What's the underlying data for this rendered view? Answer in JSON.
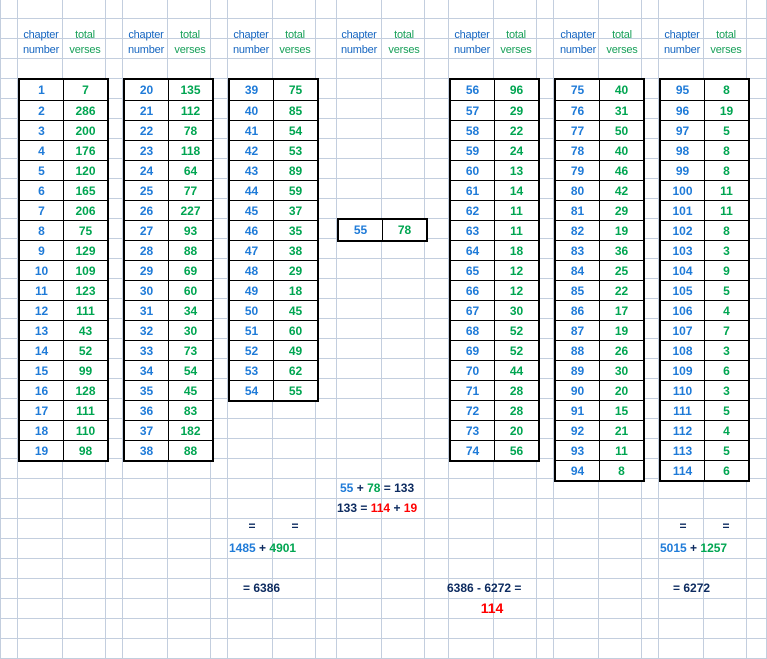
{
  "sheet": {
    "title": "Quran chapter verse counts worksheet",
    "header": {
      "chapter_line1": "chapter",
      "chapter_line2": "number",
      "verses_line1": "total",
      "verses_line2": "verses"
    },
    "colors": {
      "chapter": "#1f7bd8",
      "verses": "#00a551",
      "navy": "#0d2b60",
      "red": "#ff0000",
      "gridline": "#c3cede",
      "border": "#000000"
    }
  },
  "chart_data": {
    "type": "table",
    "title": "Quran chapter verse counts worksheet",
    "columns": [
      "chapter number",
      "total verses"
    ],
    "blocks": [
      {
        "id": "block-1",
        "rows": [
          [
            1,
            7
          ],
          [
            2,
            286
          ],
          [
            3,
            200
          ],
          [
            4,
            176
          ],
          [
            5,
            120
          ],
          [
            6,
            165
          ],
          [
            7,
            206
          ],
          [
            8,
            75
          ],
          [
            9,
            129
          ],
          [
            10,
            109
          ],
          [
            11,
            123
          ],
          [
            12,
            111
          ],
          [
            13,
            43
          ],
          [
            14,
            52
          ],
          [
            15,
            99
          ],
          [
            16,
            128
          ],
          [
            17,
            111
          ],
          [
            18,
            110
          ],
          [
            19,
            98
          ]
        ]
      },
      {
        "id": "block-2",
        "rows": [
          [
            20,
            135
          ],
          [
            21,
            112
          ],
          [
            22,
            78
          ],
          [
            23,
            118
          ],
          [
            24,
            64
          ],
          [
            25,
            77
          ],
          [
            26,
            227
          ],
          [
            27,
            93
          ],
          [
            28,
            88
          ],
          [
            29,
            69
          ],
          [
            30,
            60
          ],
          [
            31,
            34
          ],
          [
            32,
            30
          ],
          [
            33,
            73
          ],
          [
            34,
            54
          ],
          [
            35,
            45
          ],
          [
            36,
            83
          ],
          [
            37,
            182
          ],
          [
            38,
            88
          ]
        ]
      },
      {
        "id": "block-3",
        "rows": [
          [
            39,
            75
          ],
          [
            40,
            85
          ],
          [
            41,
            54
          ],
          [
            42,
            53
          ],
          [
            43,
            89
          ],
          [
            44,
            59
          ],
          [
            45,
            37
          ],
          [
            46,
            35
          ],
          [
            47,
            38
          ],
          [
            48,
            29
          ],
          [
            49,
            18
          ],
          [
            50,
            45
          ],
          [
            51,
            60
          ],
          [
            52,
            49
          ],
          [
            53,
            62
          ],
          [
            54,
            55
          ]
        ]
      },
      {
        "id": "block-4",
        "rows": [
          [
            55,
            78
          ]
        ]
      },
      {
        "id": "block-5",
        "rows": [
          [
            56,
            96
          ],
          [
            57,
            29
          ],
          [
            58,
            22
          ],
          [
            59,
            24
          ],
          [
            60,
            13
          ],
          [
            61,
            14
          ],
          [
            62,
            11
          ],
          [
            63,
            11
          ],
          [
            64,
            18
          ],
          [
            65,
            12
          ],
          [
            66,
            12
          ],
          [
            67,
            30
          ],
          [
            68,
            52
          ],
          [
            69,
            52
          ],
          [
            70,
            44
          ],
          [
            71,
            28
          ],
          [
            72,
            28
          ],
          [
            73,
            20
          ],
          [
            74,
            56
          ]
        ]
      },
      {
        "id": "block-6",
        "rows": [
          [
            75,
            40
          ],
          [
            76,
            31
          ],
          [
            77,
            50
          ],
          [
            78,
            40
          ],
          [
            79,
            46
          ],
          [
            80,
            42
          ],
          [
            81,
            29
          ],
          [
            82,
            19
          ],
          [
            83,
            36
          ],
          [
            84,
            25
          ],
          [
            85,
            22
          ],
          [
            86,
            17
          ],
          [
            87,
            19
          ],
          [
            88,
            26
          ],
          [
            89,
            30
          ],
          [
            90,
            20
          ],
          [
            91,
            15
          ],
          [
            92,
            21
          ],
          [
            93,
            11
          ],
          [
            94,
            8
          ]
        ]
      },
      {
        "id": "block-7",
        "rows": [
          [
            95,
            8
          ],
          [
            96,
            19
          ],
          [
            97,
            5
          ],
          [
            98,
            8
          ],
          [
            99,
            8
          ],
          [
            100,
            11
          ],
          [
            101,
            11
          ],
          [
            102,
            8
          ],
          [
            103,
            3
          ],
          [
            104,
            9
          ],
          [
            105,
            5
          ],
          [
            106,
            4
          ],
          [
            107,
            7
          ],
          [
            108,
            3
          ],
          [
            109,
            6
          ],
          [
            110,
            3
          ],
          [
            111,
            5
          ],
          [
            112,
            4
          ],
          [
            113,
            5
          ],
          [
            114,
            6
          ]
        ]
      }
    ]
  },
  "calculations": {
    "eq1": {
      "a": "55",
      "plus": "+",
      "b": "78",
      "equals": "=",
      "result": "133"
    },
    "eq2": {
      "a": "133",
      "equals": "=",
      "b": "114",
      "plus": "+",
      "c": "19"
    },
    "equals_left_1": "=",
    "equals_left_2": "=",
    "sum_left": {
      "a": "1485",
      "plus": "+",
      "b": "4901"
    },
    "total_left": {
      "equals": "=",
      "value": "6386"
    },
    "equals_right_1": "=",
    "equals_right_2": "=",
    "sum_right": {
      "a": "5015",
      "plus": "+",
      "b": "1257"
    },
    "total_right": {
      "equals": "=",
      "value": "6272"
    },
    "difference": {
      "expr": "6386 - 6272 =",
      "value": "114"
    }
  }
}
